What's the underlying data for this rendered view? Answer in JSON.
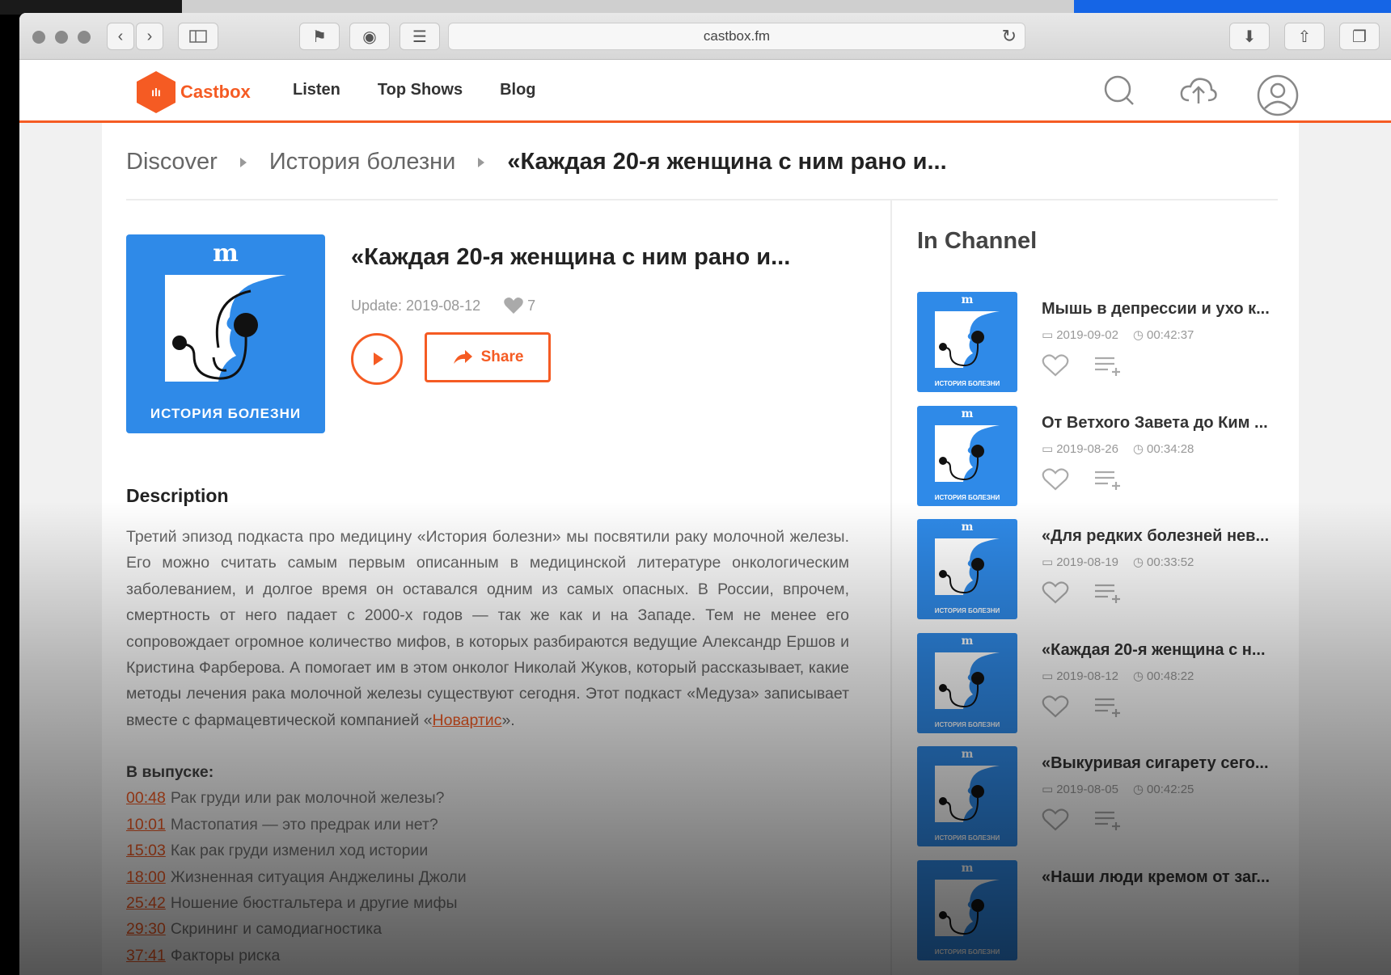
{
  "browser": {
    "address": "castbox.fm"
  },
  "site": {
    "logo_text": "Castbox",
    "nav": [
      "Listen",
      "Top Shows",
      "Blog"
    ]
  },
  "breadcrumb": {
    "items": [
      "Discover",
      "История болезни"
    ],
    "current": "«Каждая 20-я женщина с ним рано и..."
  },
  "episode": {
    "cover_mark": "m",
    "cover_caption": "ИСТОРИЯ БОЛЕЗНИ",
    "title": "«Каждая 20-я женщина с ним рано и...",
    "update": "Update: 2019-08-12",
    "likes": "7",
    "share_label": "Share"
  },
  "description": {
    "heading": "Description",
    "text": "Третий эпизод подкаста про медицину «История болезни» мы посвятили раку молочной железы. Его можно считать самым первым описанным в медицинской литературе онкологическим заболеванием, и долгое время он оставался одним из самых опасных. В России, впрочем, смертность от него падает с 2000-х годов — так же как и на Западе. Тем не менее его сопровождает огромное количество мифов, в которых разбираются ведущие Александр Ершов и Кристина Фарберова. А помогает им в этом онколог Николай Жуков, который рассказывает, какие методы лечения рака молочной железы существуют сегодня. Этот подкаст «Медуза» записывает вместе с фармацевтической компанией «",
    "link": "Новартис",
    "text_end": "».",
    "in_episode_label": "В выпуске:",
    "chapters": [
      {
        "time": "00:48",
        "title": "Рак груди или рак молочной железы?"
      },
      {
        "time": "10:01",
        "title": "Мастопатия — это предрак или нет?"
      },
      {
        "time": "15:03",
        "title": "Как рак груди изменил ход истории"
      },
      {
        "time": "18:00",
        "title": "Жизненная ситуация Анджелины Джоли"
      },
      {
        "time": "25:42",
        "title": "Ношение бюстгальтера и другие мифы"
      },
      {
        "time": "29:30",
        "title": "Скрининг и самодиагностика"
      },
      {
        "time": "37:41",
        "title": "Факторы риска"
      }
    ]
  },
  "channel": {
    "heading": "In Channel",
    "items": [
      {
        "title": "Мышь в депрессии и ухо к...",
        "date": "2019-09-02",
        "duration": "00:42:37"
      },
      {
        "title": "От Ветхого Завета до Ким ...",
        "date": "2019-08-26",
        "duration": "00:34:28"
      },
      {
        "title": "«Для редких болезней нев...",
        "date": "2019-08-19",
        "duration": "00:33:52"
      },
      {
        "title": "«Каждая 20-я женщина с н...",
        "date": "2019-08-12",
        "duration": "00:48:22"
      },
      {
        "title": "«Выкуривая сигарету сего...",
        "date": "2019-08-05",
        "duration": "00:42:25"
      },
      {
        "title": "«Наши люди кремом от заг...",
        "date": "",
        "duration": ""
      }
    ]
  },
  "colors": {
    "accent": "#f55b23",
    "cover_blue": "#2f8ae8"
  }
}
